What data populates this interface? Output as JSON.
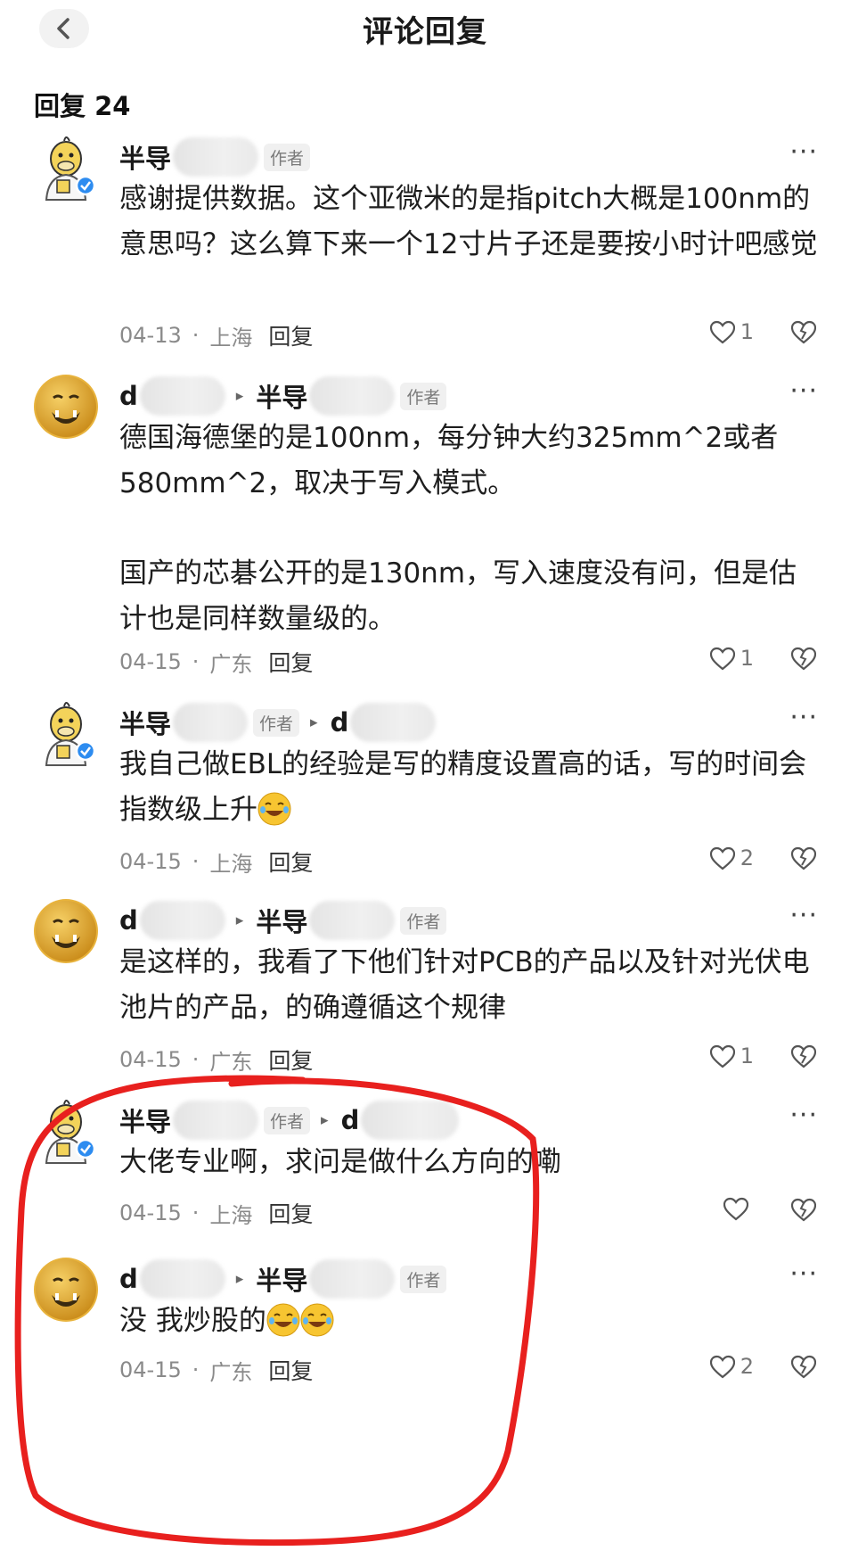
{
  "header": {
    "title": "评论回复"
  },
  "reply_count_label": "回复 24",
  "comments": [
    {
      "user": "半导",
      "author_tag": "作者",
      "reply_to": "",
      "text": "感谢提供数据。这个亚微米的是指pitch大概是100nm的意思吗？这么算下来一个12寸片子还是要按小时计吧感觉",
      "date": "04-13",
      "location": "上海",
      "reply_label": "回复",
      "likes": "1"
    },
    {
      "user": "d",
      "author_tag": "作者",
      "reply_to": "半导",
      "text": "德国海德堡的是100nm，每分钟大约325mm^2或者580mm^2，取决于写入模式。",
      "text2": "国产的芯碁公开的是130nm，写入速度没有问，但是估计也是同样数量级的。",
      "date": "04-15",
      "location": "广东",
      "reply_label": "回复",
      "likes": "1"
    },
    {
      "user": "半导",
      "author_tag": "作者",
      "reply_to": "d",
      "text": "我自己做EBL的经验是写的精度设置高的话，写的时间会指数级上升",
      "date": "04-15",
      "location": "上海",
      "reply_label": "回复",
      "likes": "2"
    },
    {
      "user": "d",
      "author_tag": "作者",
      "reply_to": "半导",
      "text": "是这样的，我看了下他们针对PCB的产品以及针对光伏电池片的产品，的确遵循这个规律",
      "date": "04-15",
      "location": "广东",
      "reply_label": "回复",
      "likes": "1"
    },
    {
      "user": "半导",
      "author_tag": "作者",
      "reply_to": "d",
      "text": "大佬专业啊，求问是做什么方向的嘞",
      "date": "04-15",
      "location": "上海",
      "reply_label": "回复",
      "likes": ""
    },
    {
      "user": "d",
      "author_tag": "作者",
      "reply_to": "半导",
      "text": "没 我炒股的",
      "date": "04-15",
      "location": "广东",
      "reply_label": "回复",
      "likes": "2"
    }
  ],
  "colors": {
    "highlight_circle": "#e8201e",
    "author_tag_bg": "#f0f0f0",
    "meta_text": "#8a8a8a"
  },
  "icons": [
    "back-chevron-icon",
    "more-dots-icon",
    "heart-icon",
    "dislike-icon",
    "laughing-emoji-icon",
    "verified-badge-icon"
  ]
}
